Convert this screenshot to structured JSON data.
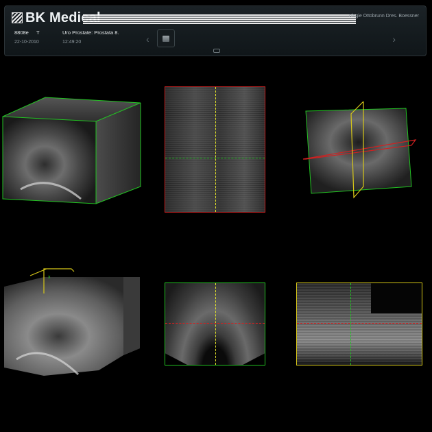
{
  "header": {
    "brand": "BK Medical",
    "clinic": "ologie Ottobrunn Dres. Boessner",
    "patient_id": "8808e",
    "patient_flag": "T",
    "exam": "Uro Prostate: Prostata 8.",
    "date": "22-10-2010",
    "time": "12:49:20",
    "prev_icon": "chevron-left-icon",
    "next_icon": "chevron-right-icon",
    "prev_glyph": "‹",
    "next_glyph": "›"
  },
  "colors": {
    "sagittal": "#d12020",
    "transverse": "#22c422",
    "coronal": "#d8c818",
    "background": "#000000"
  },
  "viewports": {
    "cube_marker": "x"
  }
}
